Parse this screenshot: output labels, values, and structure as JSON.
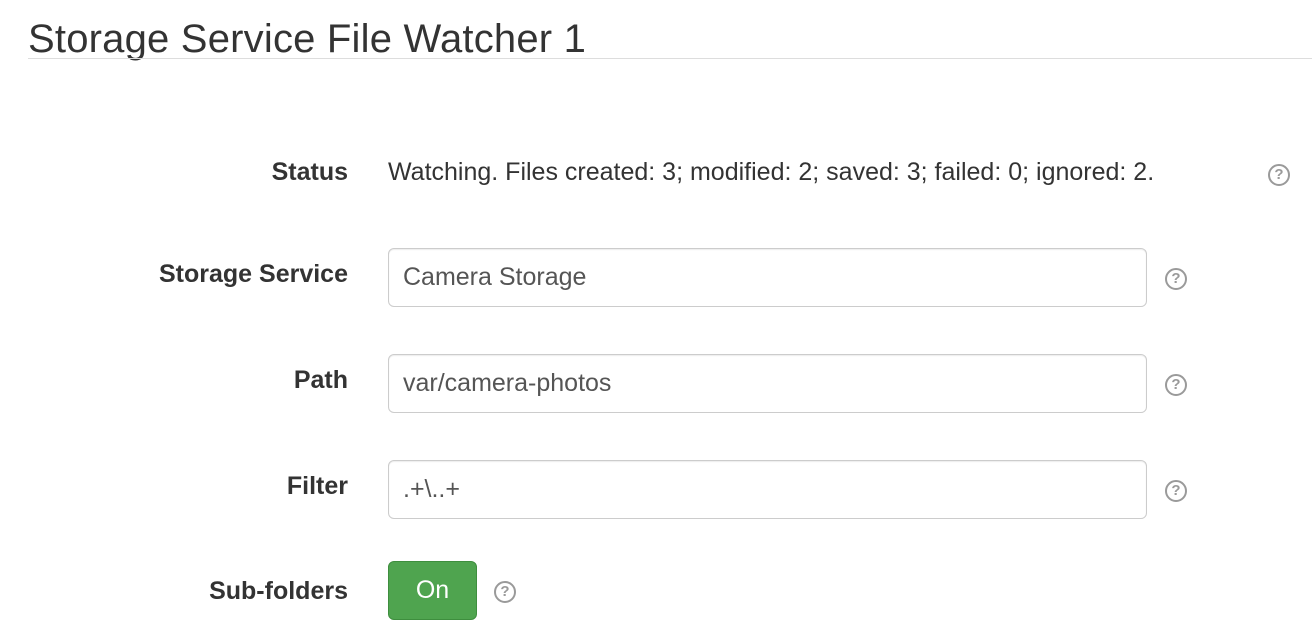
{
  "page": {
    "title": "Storage Service File Watcher 1"
  },
  "form": {
    "status": {
      "label": "Status",
      "value": "Watching. Files created: 3; modified: 2; saved: 3; failed: 0; ignored: 2.",
      "help_icon": "question-circle-icon"
    },
    "storage_service": {
      "label": "Storage Service",
      "value": "Camera Storage",
      "help_icon": "question-circle-icon"
    },
    "path": {
      "label": "Path",
      "value": "var/camera-photos",
      "help_icon": "question-circle-icon"
    },
    "filter": {
      "label": "Filter",
      "value": ".+\\..+",
      "help_icon": "question-circle-icon"
    },
    "sub_folders": {
      "label": "Sub-folders",
      "toggle_label": "On",
      "toggle_state": true,
      "toggle_color": "#4fa44f",
      "help_icon": "question-circle-icon"
    }
  },
  "help_icon_glyph": "?"
}
